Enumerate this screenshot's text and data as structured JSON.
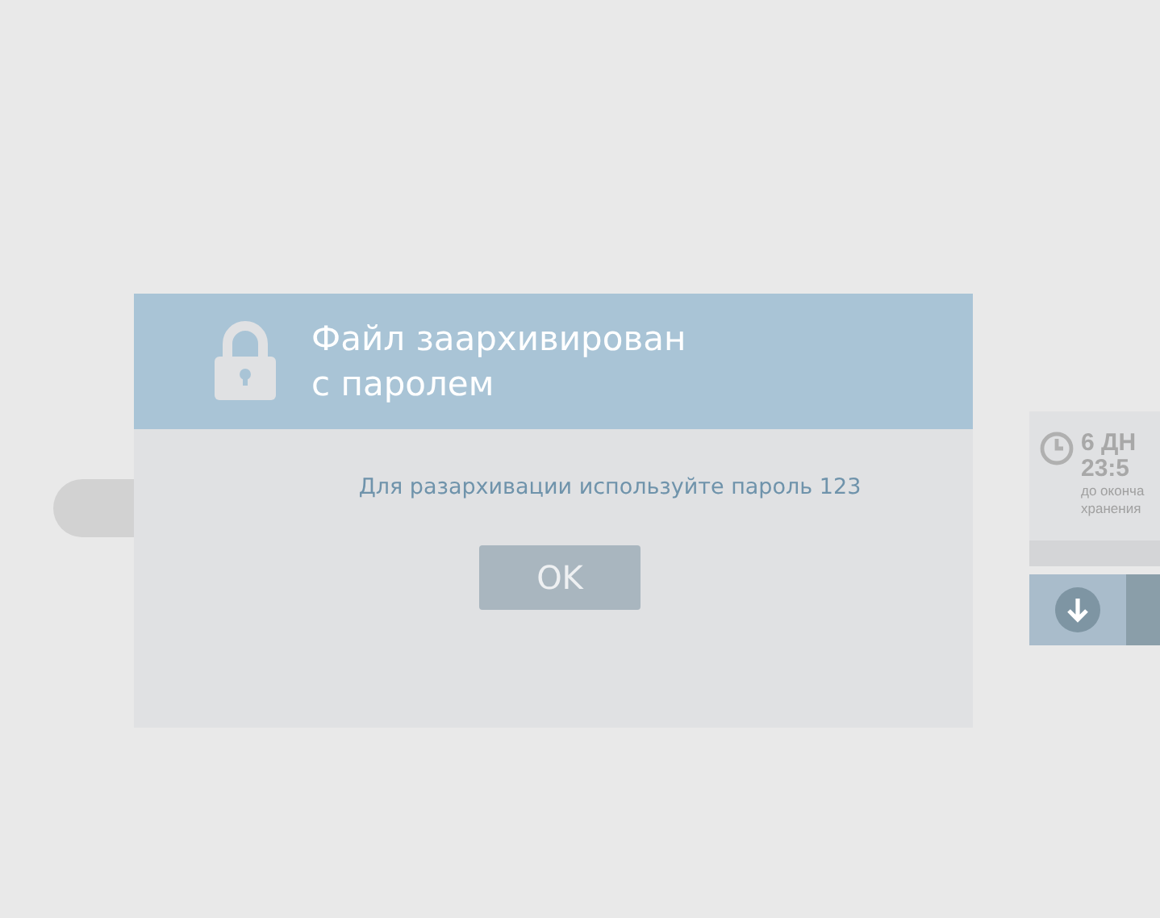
{
  "dialog": {
    "title_lines": [
      "Файл заархивирован",
      "с паролем"
    ],
    "message": "Для разархивации используйте пароль 123",
    "button": "OK"
  },
  "side_panel": {
    "days": "6 ДН",
    "time": "23:5",
    "caption_lines": [
      "до оконча",
      "хранения"
    ]
  }
}
